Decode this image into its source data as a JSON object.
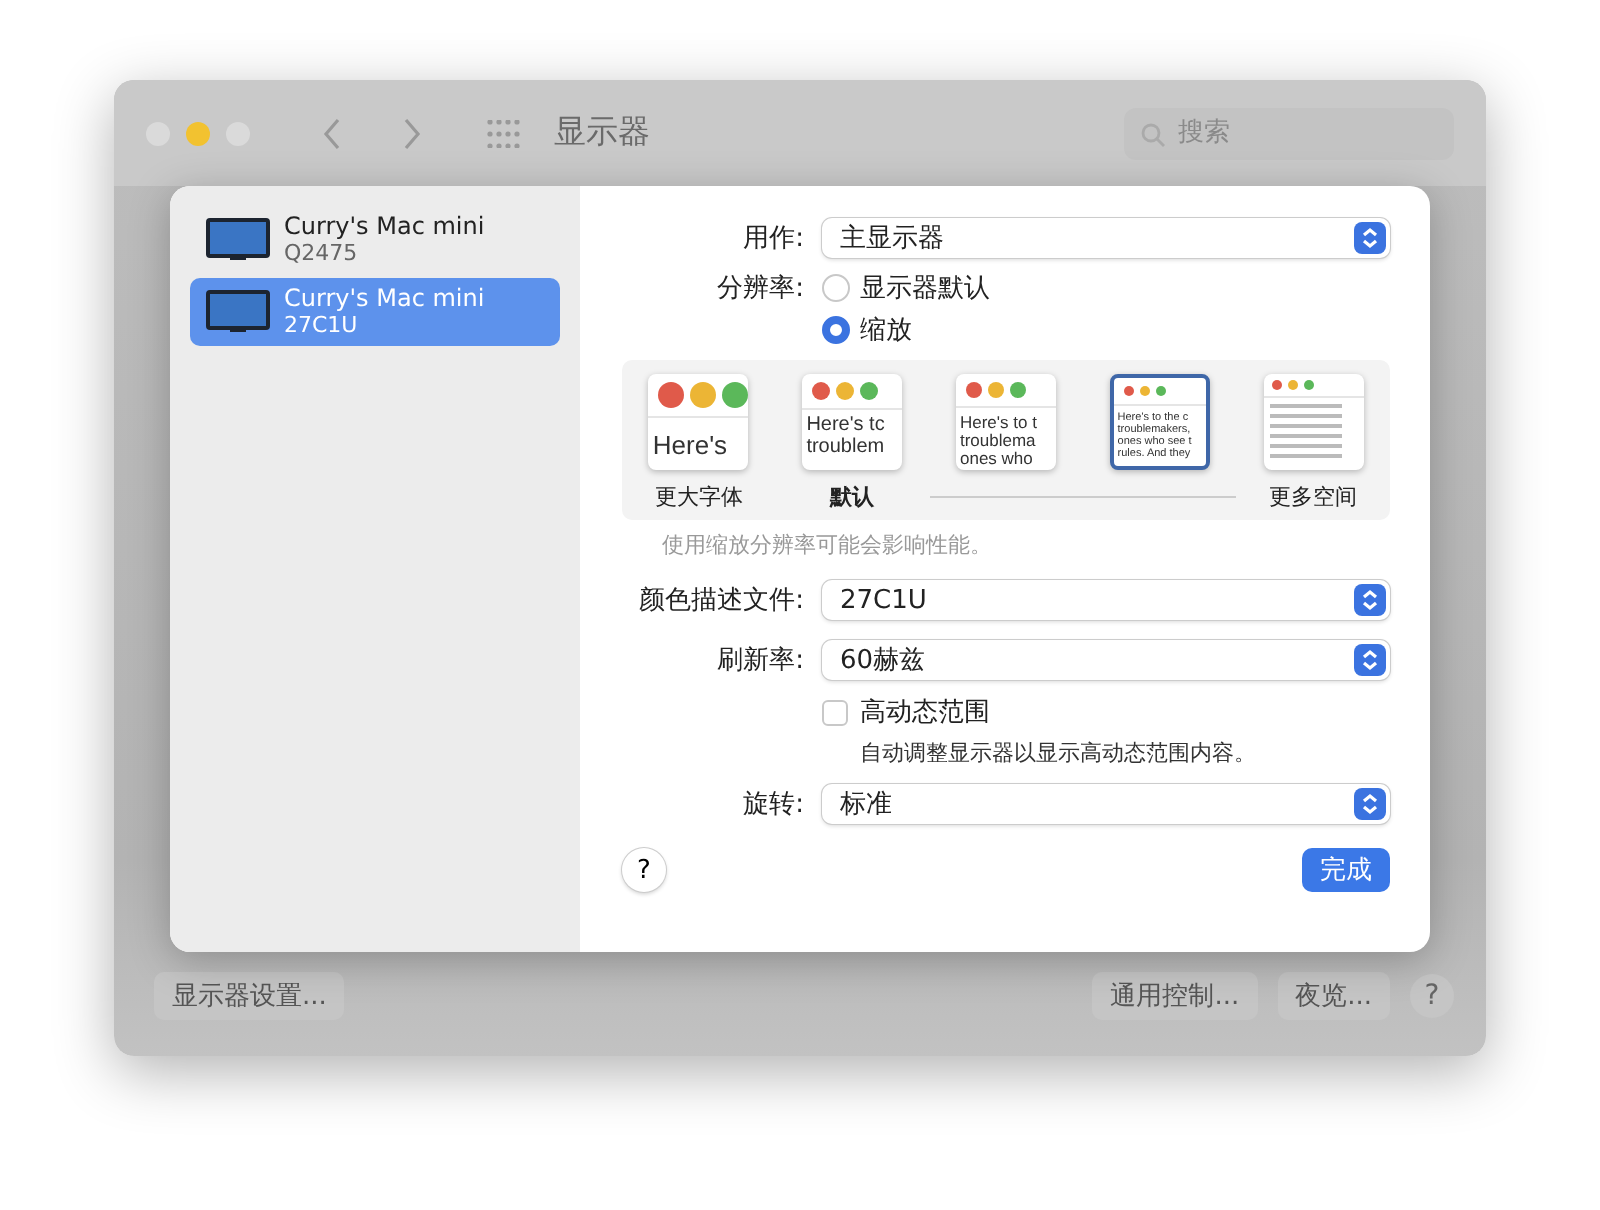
{
  "window": {
    "title": "显示器",
    "search": {
      "placeholder": "搜索"
    }
  },
  "bottom_buttons": {
    "left": "显示器设置...",
    "right": [
      "通用控制...",
      "夜览..."
    ],
    "help": "?"
  },
  "sheet": {
    "displays": [
      {
        "name": "Curry's Mac mini",
        "model": "Q2475",
        "selected": false
      },
      {
        "name": "Curry's Mac mini",
        "model": "27C1U",
        "selected": true
      }
    ],
    "use_as": {
      "label": "用作:",
      "value": "主显示器"
    },
    "resolution": {
      "label": "分辨率:",
      "options": [
        {
          "label": "显示器默认",
          "selected": false
        },
        {
          "label": "缩放",
          "selected": true
        }
      ]
    },
    "scales": [
      {
        "kind": "text",
        "lines": [
          "Here's"
        ],
        "label": "更大字体",
        "selected": false,
        "emphasis": false
      },
      {
        "kind": "text",
        "lines": [
          "Here's tc",
          "troublem"
        ],
        "label": "默认",
        "selected": false,
        "emphasis": true
      },
      {
        "kind": "text",
        "lines": [
          "Here's to t",
          "troublema",
          "ones who"
        ],
        "selected": false
      },
      {
        "kind": "text",
        "lines": [
          "Here's to the c",
          "troublemakers,",
          "ones who see t",
          "rules. And they"
        ],
        "selected": true
      },
      {
        "kind": "lines",
        "label": "更多空间",
        "selected": false,
        "emphasis": false
      }
    ],
    "scale_note": "使用缩放分辨率可能会影响性能。",
    "color_profile": {
      "label": "颜色描述文件:",
      "value": "27C1U"
    },
    "refresh_rate": {
      "label": "刷新率:",
      "value": "60赫兹"
    },
    "hdr": {
      "label": "高动态范围",
      "checked": false,
      "description": "自动调整显示器以显示高动态范围内容。"
    },
    "rotation": {
      "label": "旋转:",
      "value": "标准"
    },
    "help": "?",
    "done": "完成"
  }
}
